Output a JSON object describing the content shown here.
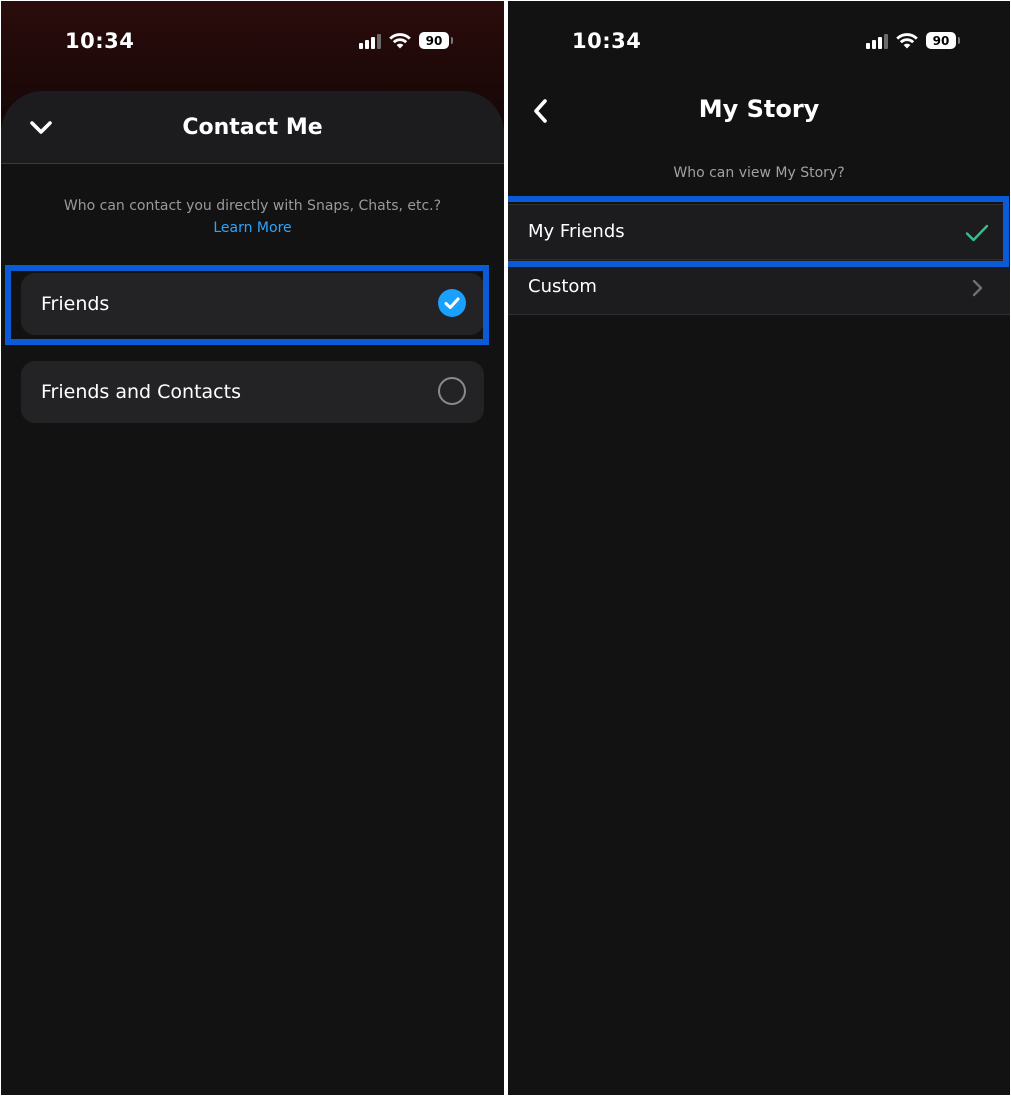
{
  "left_screen": {
    "status_bar": {
      "time": "10:34",
      "battery": "90"
    },
    "sheet": {
      "title": "Contact Me",
      "collapse_icon": "chevron-down-icon",
      "subtitle": "Who can contact you directly with Snaps, Chats, etc.?",
      "learn_more": "Learn More",
      "options": [
        {
          "label": "Friends",
          "selected": true
        },
        {
          "label": "Friends and Contacts",
          "selected": false
        }
      ]
    }
  },
  "right_screen": {
    "status_bar": {
      "time": "10:34",
      "battery": "90"
    },
    "header": {
      "title": "My Story",
      "back_icon": "chevron-left-icon"
    },
    "subtitle": "Who can view My Story?",
    "options": [
      {
        "label": "My Friends",
        "trailing": "checkmark-icon",
        "selected": true
      },
      {
        "label": "Custom",
        "trailing": "chevron-right-icon",
        "selected": false
      }
    ]
  },
  "colors": {
    "background": "#121212",
    "card": "#232325",
    "accent_blue": "#1aa0ff",
    "link_blue": "#2aa5ff",
    "highlight_box": "#0b5bd6",
    "check_green": "#30c28a"
  }
}
